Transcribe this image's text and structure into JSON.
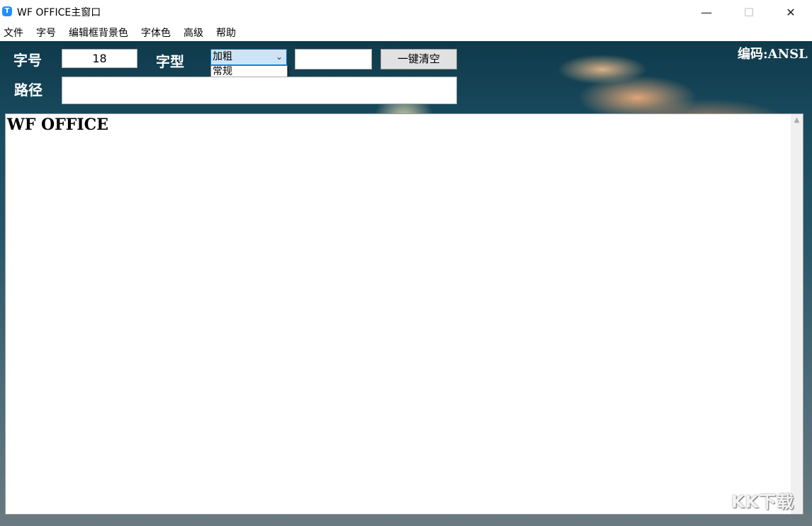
{
  "window": {
    "title": "WF OFFICE主窗口",
    "app_icon": "T"
  },
  "controls": {
    "minimize": "—",
    "maximize": "☐",
    "close": "✕"
  },
  "menu": [
    "文件",
    "字号",
    "编辑框背景色",
    "字体色",
    "高级",
    "帮助"
  ],
  "toolbar": {
    "size_label": "字号",
    "size_value": "18",
    "style_label": "字型",
    "style_selected": "加粗",
    "style_options": [
      "常规",
      "加粗"
    ],
    "clear_button": "一键清空",
    "path_label": "路径",
    "path_value": ""
  },
  "encoding": "编码:ANSL",
  "editor": {
    "content": "WF OFFICE"
  },
  "watermark": "KK下载",
  "colors": {
    "accent": "#0078d7",
    "selected_bg": "#cce4f7"
  }
}
